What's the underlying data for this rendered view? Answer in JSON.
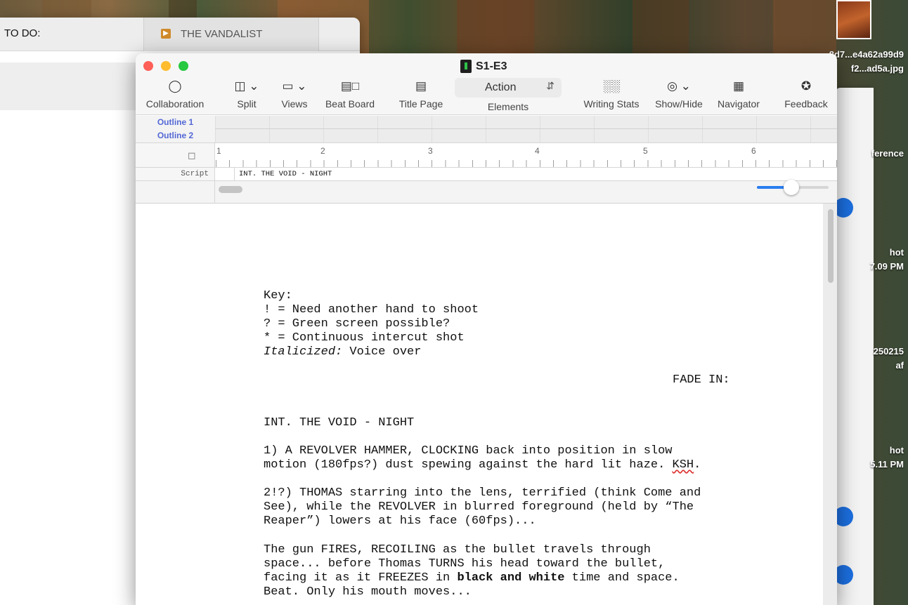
{
  "todo_window": {
    "title": "TO DO:",
    "tab_label": "THE VANDALIST"
  },
  "desktop": {
    "labels": [
      "8d7...e4a62a99d9",
      "f2...ad5a.jpg",
      "ference",
      "hot",
      "7.09 PM",
      "250215",
      "af",
      "hot",
      "5.11 PM"
    ]
  },
  "app": {
    "title": "S1-E3",
    "toolbar": {
      "collaboration": "Collaboration",
      "split": "Split",
      "views": "Views",
      "beat_board": "Beat Board",
      "title_page": "Title Page",
      "elements_value": "Action",
      "elements": "Elements",
      "writing_stats": "Writing Stats",
      "show_hide": "Show/Hide",
      "navigator": "Navigator",
      "feedback": "Feedback"
    },
    "outline": {
      "row1": "Outline 1",
      "row2": "Outline 2"
    },
    "ruler": [
      "1",
      "2",
      "3",
      "4",
      "5",
      "6"
    ],
    "script_label": "Script",
    "script_scene": "INT. THE VOID - NIGHT",
    "zoom_level": 0.48,
    "document": {
      "key_heading": "Key:",
      "key_1": "! = Need another hand to shoot",
      "key_2": "? = Green screen possible?",
      "key_3": "* = Continuous intercut shot",
      "key_4_italic": "Italicized:",
      "key_4_rest": " Voice over",
      "transition": "FADE IN:",
      "scene_heading": "INT. THE VOID - NIGHT",
      "p1_line1": "1) A REVOLVER HAMMER, CLOCKING back into position in slow",
      "p1_line2a": "motion (180fps?) dust spewing against the hard lit haze. ",
      "p1_line2b": "KSH",
      "p1_line2c": ".",
      "p2_line1": "2!?) THOMAS starring into the lens, terrified (think Come and",
      "p2_line2": "See), while the REVOLVER in blurred foreground (held by “The",
      "p2_line3": "Reaper”) lowers at his face (60fps)...",
      "p3_line1": "The gun FIRES, RECOILING as the bullet travels through",
      "p3_line2": "space... before Thomas TURNS his head toward the bullet,",
      "p3_line3a": "facing it as it FREEZES in ",
      "p3_line3b": "black and white",
      "p3_line3c": " time and space.",
      "p3_line4": "Beat. Only his mouth moves..."
    }
  },
  "colors": {
    "outline_label": "#5468d6",
    "zoom_accent": "#2a7ef0",
    "traffic_red": "#fe5f57",
    "traffic_yellow": "#febc2e",
    "traffic_green": "#28c840"
  }
}
